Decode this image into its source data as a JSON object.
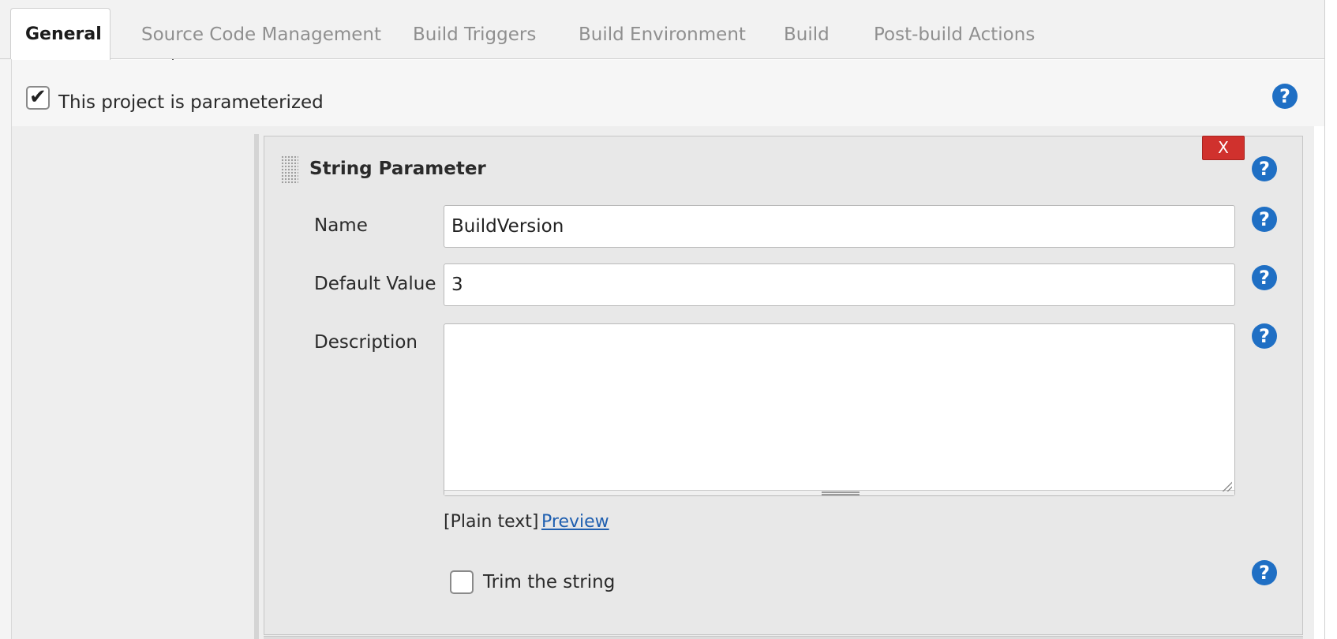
{
  "tabs": [
    {
      "label": "General",
      "active": true
    },
    {
      "label": "Source Code Management",
      "active": false
    },
    {
      "label": "Build Triggers",
      "active": false
    },
    {
      "label": "Build Environment",
      "active": false
    },
    {
      "label": "Build",
      "active": false
    },
    {
      "label": "Post-build Actions",
      "active": false
    }
  ],
  "parameterized": {
    "label": "This project is parameterized",
    "checked": true,
    "check_glyph": "✔",
    "help_icon": "?"
  },
  "string_parameter": {
    "title": "String Parameter",
    "delete_label": "X",
    "help_icon": "?",
    "name": {
      "label": "Name",
      "value": "BuildVersion"
    },
    "default_value": {
      "label": "Default Value",
      "value": "3"
    },
    "description": {
      "label": "Description",
      "value": ""
    },
    "format_hint": "[Plain text]",
    "preview_link": "Preview",
    "trim": {
      "label": "Trim the string",
      "checked": false
    }
  },
  "colors": {
    "help_blue": "#1f6fc4",
    "delete_red": "#d0312d",
    "link_blue": "#1f5fb0"
  }
}
